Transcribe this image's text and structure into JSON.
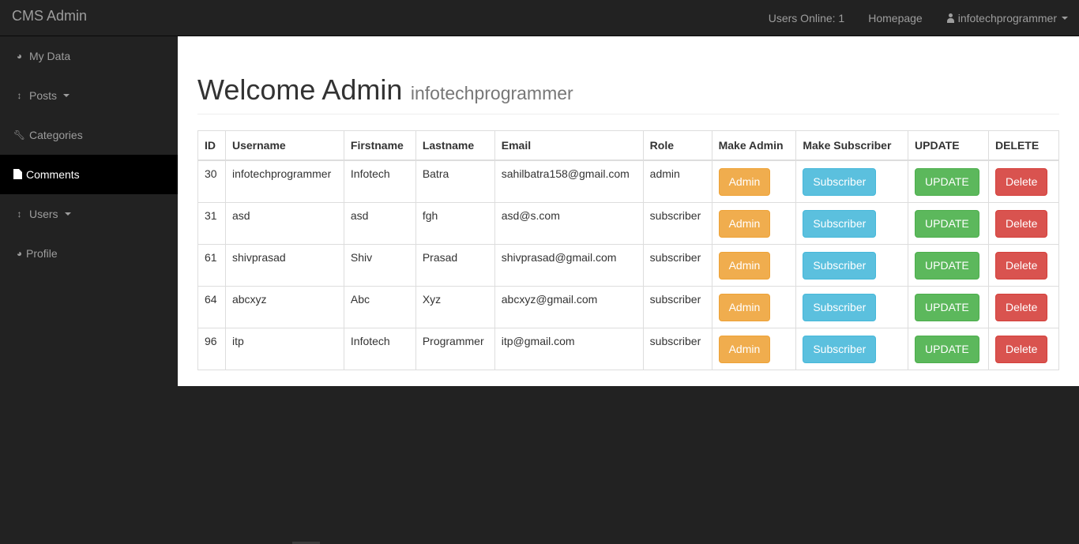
{
  "app": {
    "brand": "CMS Admin"
  },
  "topnav": {
    "users_online": "Users Online: 1",
    "homepage": "Homepage",
    "user": "infotechprogrammer"
  },
  "sidebar": {
    "items": [
      {
        "label": "My Data",
        "icon": "dashboard-icon"
      },
      {
        "label": "Posts",
        "icon": "resize-vertical-icon"
      },
      {
        "label": "Categories",
        "icon": "wrench-icon"
      },
      {
        "label": "Comments",
        "icon": "file-icon",
        "active": true
      },
      {
        "label": "Users",
        "icon": "resize-vertical-icon"
      },
      {
        "label": "Profile",
        "icon": "dashboard-icon"
      }
    ]
  },
  "main": {
    "title": "Welcome Admin",
    "subtitle": "infotechprogrammer"
  },
  "table": {
    "headers": [
      "ID",
      "Username",
      "Firstname",
      "Lastname",
      "Email",
      "Role",
      "Make Admin",
      "Make Subscriber",
      "UPDATE",
      "DELETE"
    ],
    "actions": {
      "admin": "Admin",
      "subscriber": "Subscriber",
      "update": "UPDATE",
      "delete": "Delete"
    },
    "rows": [
      {
        "id": "30",
        "username": "infotechprogrammer",
        "firstname": "Infotech",
        "lastname": "Batra",
        "email": "sahilbatra158@gmail.com",
        "role": "admin"
      },
      {
        "id": "31",
        "username": "asd",
        "firstname": "asd",
        "lastname": "fgh",
        "email": "asd@s.com",
        "role": "subscriber"
      },
      {
        "id": "61",
        "username": "shivprasad",
        "firstname": "Shiv",
        "lastname": "Prasad",
        "email": "shivprasad@gmail.com",
        "role": "subscriber"
      },
      {
        "id": "64",
        "username": "abcxyz",
        "firstname": "Abc",
        "lastname": "Xyz",
        "email": "abcxyz@gmail.com",
        "role": "subscriber"
      },
      {
        "id": "96",
        "username": "itp",
        "firstname": "Infotech",
        "lastname": "Programmer",
        "email": "itp@gmail.com",
        "role": "subscriber"
      }
    ]
  },
  "colors": {
    "navbar": "#222222",
    "sidebar_active": "#000000",
    "admin_btn": "#f0ad4e",
    "subscriber_btn": "#5bc0de",
    "update_btn": "#5cb85c",
    "delete_btn": "#d9534f"
  }
}
